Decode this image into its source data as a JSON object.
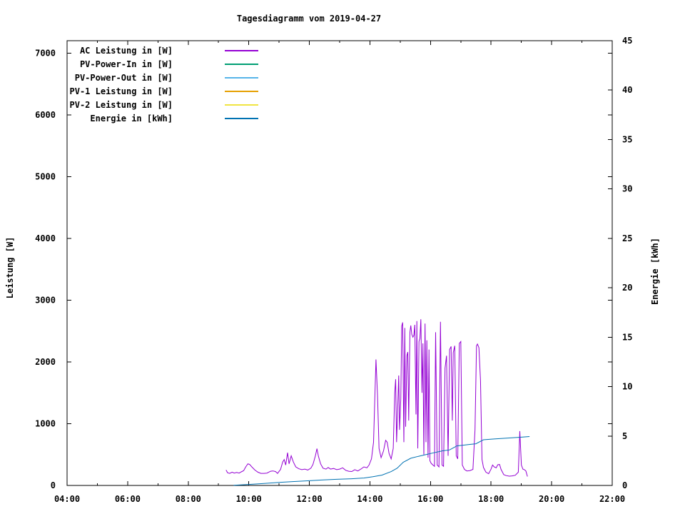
{
  "title": "Tagesdiagramm vom 2019-04-27",
  "chart_data": {
    "type": "line",
    "title": "Tagesdiagramm vom 2019-04-27",
    "background_color": "#ffffff",
    "border_color": "#000000",
    "grid": false,
    "legend_position": "top-left-inside",
    "axes": {
      "x": {
        "unit": "time",
        "start_hour": 4,
        "end_hour": 22,
        "major_step_hours": 2,
        "minor_step_hours": 1,
        "tick_labels": [
          "04:00",
          "06:00",
          "08:00",
          "10:00",
          "12:00",
          "14:00",
          "16:00",
          "18:00",
          "20:00",
          "22:00"
        ]
      },
      "y_left": {
        "label": "Leistung [W]",
        "min": 0,
        "max": 7200,
        "tick_step": 1000,
        "tick_values": [
          0,
          1000,
          2000,
          3000,
          4000,
          5000,
          6000,
          7000
        ],
        "tick_labels": [
          "0",
          "1000",
          "2000",
          "3000",
          "4000",
          "5000",
          "6000",
          "7000"
        ]
      },
      "y_right": {
        "label": "Energie [kWh]",
        "min": 0,
        "max": 45,
        "tick_step": 5,
        "tick_values": [
          0,
          5,
          10,
          15,
          20,
          25,
          30,
          35,
          40,
          45
        ],
        "tick_labels": [
          "0",
          "5",
          "10",
          "15",
          "20",
          "25",
          "30",
          "35",
          "40",
          "45"
        ]
      }
    },
    "series": [
      {
        "name": "AC Leistung in [W]",
        "color": "#9400d3",
        "axis": "left",
        "points": [
          [
            9.25,
            250
          ],
          [
            9.3,
            205
          ],
          [
            9.37,
            195
          ],
          [
            9.45,
            215
          ],
          [
            9.52,
            200
          ],
          [
            9.6,
            210
          ],
          [
            9.68,
            200
          ],
          [
            9.75,
            220
          ],
          [
            9.83,
            240
          ],
          [
            9.9,
            300
          ],
          [
            9.97,
            350
          ],
          [
            10.03,
            340
          ],
          [
            10.1,
            300
          ],
          [
            10.2,
            250
          ],
          [
            10.3,
            215
          ],
          [
            10.4,
            195
          ],
          [
            10.5,
            195
          ],
          [
            10.6,
            200
          ],
          [
            10.72,
            230
          ],
          [
            10.8,
            235
          ],
          [
            10.88,
            225
          ],
          [
            10.95,
            195
          ],
          [
            11.05,
            260
          ],
          [
            11.12,
            380
          ],
          [
            11.17,
            420
          ],
          [
            11.22,
            330
          ],
          [
            11.28,
            530
          ],
          [
            11.33,
            350
          ],
          [
            11.4,
            480
          ],
          [
            11.47,
            380
          ],
          [
            11.55,
            300
          ],
          [
            11.65,
            270
          ],
          [
            11.75,
            255
          ],
          [
            11.85,
            265
          ],
          [
            11.95,
            250
          ],
          [
            12.05,
            280
          ],
          [
            12.12,
            340
          ],
          [
            12.2,
            480
          ],
          [
            12.25,
            595
          ],
          [
            12.3,
            470
          ],
          [
            12.37,
            350
          ],
          [
            12.45,
            280
          ],
          [
            12.55,
            265
          ],
          [
            12.62,
            290
          ],
          [
            12.7,
            265
          ],
          [
            12.8,
            275
          ],
          [
            12.9,
            255
          ],
          [
            13.0,
            265
          ],
          [
            13.1,
            285
          ],
          [
            13.2,
            245
          ],
          [
            13.3,
            230
          ],
          [
            13.4,
            225
          ],
          [
            13.5,
            255
          ],
          [
            13.6,
            235
          ],
          [
            13.7,
            265
          ],
          [
            13.8,
            300
          ],
          [
            13.9,
            285
          ],
          [
            13.97,
            330
          ],
          [
            14.05,
            430
          ],
          [
            14.12,
            700
          ],
          [
            14.2,
            2040
          ],
          [
            14.25,
            1450
          ],
          [
            14.3,
            600
          ],
          [
            14.37,
            450
          ],
          [
            14.45,
            560
          ],
          [
            14.52,
            730
          ],
          [
            14.57,
            700
          ],
          [
            14.63,
            520
          ],
          [
            14.7,
            430
          ],
          [
            14.77,
            600
          ],
          [
            14.82,
            1500
          ],
          [
            14.85,
            1720
          ],
          [
            14.88,
            700
          ],
          [
            14.92,
            1300
          ],
          [
            14.95,
            1780
          ],
          [
            14.98,
            900
          ],
          [
            15.02,
            1400
          ],
          [
            15.05,
            2580
          ],
          [
            15.08,
            2640
          ],
          [
            15.12,
            700
          ],
          [
            15.15,
            2550
          ],
          [
            15.18,
            950
          ],
          [
            15.22,
            2100
          ],
          [
            15.25,
            2160
          ],
          [
            15.28,
            1050
          ],
          [
            15.32,
            2480
          ],
          [
            15.35,
            2590
          ],
          [
            15.38,
            2450
          ],
          [
            15.42,
            2400
          ],
          [
            15.45,
            2430
          ],
          [
            15.48,
            2600
          ],
          [
            15.52,
            1150
          ],
          [
            15.55,
            2660
          ],
          [
            15.58,
            600
          ],
          [
            15.62,
            2330
          ],
          [
            15.65,
            2380
          ],
          [
            15.68,
            2690
          ],
          [
            15.72,
            1500
          ],
          [
            15.75,
            2300
          ],
          [
            15.78,
            500
          ],
          [
            15.82,
            2620
          ],
          [
            15.85,
            700
          ],
          [
            15.88,
            2350
          ],
          [
            15.92,
            450
          ],
          [
            15.95,
            2200
          ],
          [
            15.98,
            400
          ],
          [
            16.02,
            360
          ],
          [
            16.08,
            330
          ],
          [
            16.13,
            310
          ],
          [
            16.17,
            2480
          ],
          [
            16.22,
            330
          ],
          [
            16.28,
            300
          ],
          [
            16.33,
            2650
          ],
          [
            16.38,
            330
          ],
          [
            16.43,
            310
          ],
          [
            16.48,
            1900
          ],
          [
            16.53,
            2100
          ],
          [
            16.58,
            480
          ],
          [
            16.63,
            2200
          ],
          [
            16.68,
            2250
          ],
          [
            16.72,
            1050
          ],
          [
            16.75,
            2150
          ],
          [
            16.8,
            2260
          ],
          [
            16.85,
            480
          ],
          [
            16.9,
            430
          ],
          [
            16.95,
            2300
          ],
          [
            17.0,
            2330
          ],
          [
            17.05,
            330
          ],
          [
            17.12,
            260
          ],
          [
            17.2,
            235
          ],
          [
            17.3,
            240
          ],
          [
            17.4,
            260
          ],
          [
            17.47,
            900
          ],
          [
            17.52,
            2260
          ],
          [
            17.55,
            2290
          ],
          [
            17.6,
            2230
          ],
          [
            17.65,
            1700
          ],
          [
            17.7,
            420
          ],
          [
            17.75,
            290
          ],
          [
            17.83,
            215
          ],
          [
            17.92,
            190
          ],
          [
            18.0,
            265
          ],
          [
            18.05,
            330
          ],
          [
            18.1,
            300
          ],
          [
            18.17,
            285
          ],
          [
            18.22,
            335
          ],
          [
            18.28,
            340
          ],
          [
            18.33,
            260
          ],
          [
            18.42,
            175
          ],
          [
            18.5,
            160
          ],
          [
            18.6,
            150
          ],
          [
            18.7,
            155
          ],
          [
            18.8,
            165
          ],
          [
            18.9,
            215
          ],
          [
            18.95,
            880
          ],
          [
            19.0,
            330
          ],
          [
            19.05,
            265
          ],
          [
            19.1,
            255
          ],
          [
            19.15,
            235
          ],
          [
            19.2,
            145
          ]
        ]
      },
      {
        "name": "PV-Power-In in [W]",
        "color": "#009e73",
        "axis": "left",
        "points": []
      },
      {
        "name": "PV-Power-Out in [W]",
        "color": "#56b4e9",
        "axis": "left",
        "points": []
      },
      {
        "name": "PV-1 Leistung in [W]",
        "color": "#e69f00",
        "axis": "left",
        "points": []
      },
      {
        "name": "PV-2 Leistung in [W]",
        "color": "#f0e442",
        "axis": "left",
        "points": []
      },
      {
        "name": "Energie in [kWh]",
        "color": "#0072b2",
        "axis": "right",
        "points": [
          [
            9.5,
            0.02
          ],
          [
            10.0,
            0.1
          ],
          [
            10.5,
            0.2
          ],
          [
            11.0,
            0.3
          ],
          [
            11.5,
            0.4
          ],
          [
            12.0,
            0.48
          ],
          [
            12.4,
            0.55
          ],
          [
            12.9,
            0.62
          ],
          [
            13.4,
            0.68
          ],
          [
            13.8,
            0.75
          ],
          [
            14.1,
            0.88
          ],
          [
            14.4,
            1.05
          ],
          [
            14.7,
            1.4
          ],
          [
            14.9,
            1.75
          ],
          [
            15.1,
            2.35
          ],
          [
            15.35,
            2.75
          ],
          [
            15.6,
            2.95
          ],
          [
            15.85,
            3.12
          ],
          [
            16.1,
            3.3
          ],
          [
            16.4,
            3.5
          ],
          [
            16.63,
            3.6
          ],
          [
            16.87,
            4.0
          ],
          [
            17.1,
            4.08
          ],
          [
            17.3,
            4.15
          ],
          [
            17.5,
            4.22
          ],
          [
            17.75,
            4.62
          ],
          [
            18.1,
            4.7
          ],
          [
            18.6,
            4.8
          ],
          [
            19.0,
            4.88
          ],
          [
            19.27,
            4.95
          ]
        ]
      }
    ]
  }
}
